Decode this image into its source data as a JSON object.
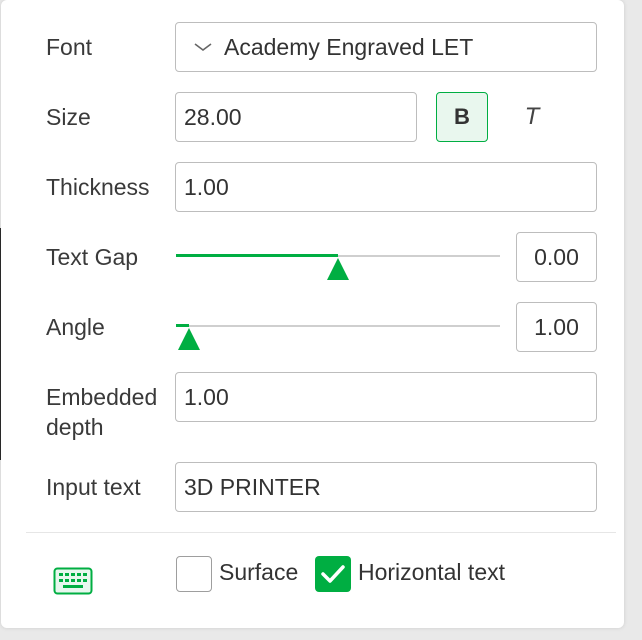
{
  "labels": {
    "font": "Font",
    "size": "Size",
    "thickness": "Thickness",
    "text_gap": "Text Gap",
    "angle": "Angle",
    "embedded_depth_1": "Embedded",
    "embedded_depth_2": "depth",
    "input_text": "Input text"
  },
  "font": {
    "value": "Academy Engraved LET"
  },
  "size": {
    "value": "28.00",
    "bold_label": "B",
    "italic_label": "T"
  },
  "thickness": {
    "value": "1.00"
  },
  "text_gap": {
    "value": "0.00",
    "slider_fraction": 0.5
  },
  "angle": {
    "value": "1.00",
    "slider_fraction": 0.04
  },
  "embedded_depth": {
    "value": "1.00"
  },
  "input_text": {
    "value": "3D PRINTER"
  },
  "footer": {
    "surface_label": "Surface",
    "surface_checked": false,
    "horizontal_label": "Horizontal text",
    "horizontal_checked": true
  },
  "colors": {
    "accent": "#00ae42",
    "border": "#bdbdbd"
  },
  "icons": {
    "combo": "chevron-down-icon",
    "keyboard": "keyboard-icon",
    "check": "checkmark-icon"
  }
}
